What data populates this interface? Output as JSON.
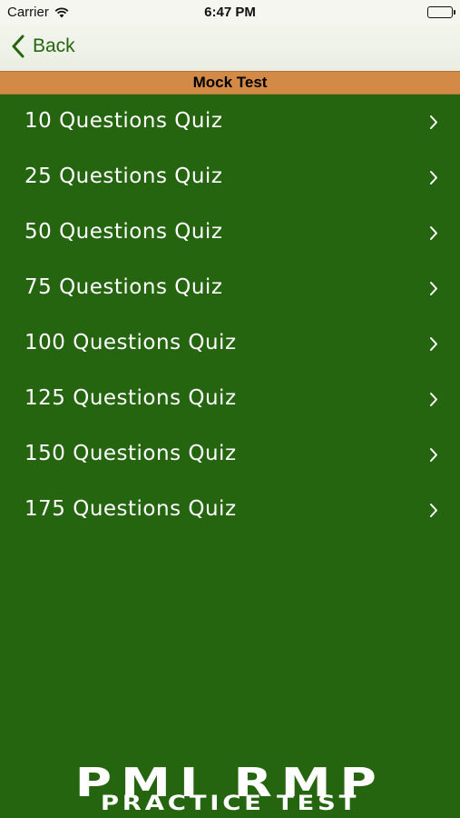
{
  "status_bar": {
    "carrier": "Carrier",
    "time": "6:47 PM",
    "icons": [
      "wifi-icon",
      "battery-icon"
    ]
  },
  "nav": {
    "back_label": "Back",
    "back_icon": "chevron-left-icon"
  },
  "section": {
    "title": "Mock Test"
  },
  "quizzes": [
    {
      "label": "10 Questions Quiz"
    },
    {
      "label": "25 Questions Quiz"
    },
    {
      "label": "50 Questions Quiz"
    },
    {
      "label": "75 Questions Quiz"
    },
    {
      "label": "100 Questions Quiz"
    },
    {
      "label": "125 Questions Quiz"
    },
    {
      "label": "150 Questions Quiz"
    },
    {
      "label": "175 Questions Quiz"
    }
  ],
  "brand": {
    "line1": "PMI RMP",
    "line2": "PRACTICE TEST"
  },
  "colors": {
    "background": "#256510",
    "section_header": "#d38a47",
    "accent": "#256510",
    "text": "#ffffff"
  }
}
